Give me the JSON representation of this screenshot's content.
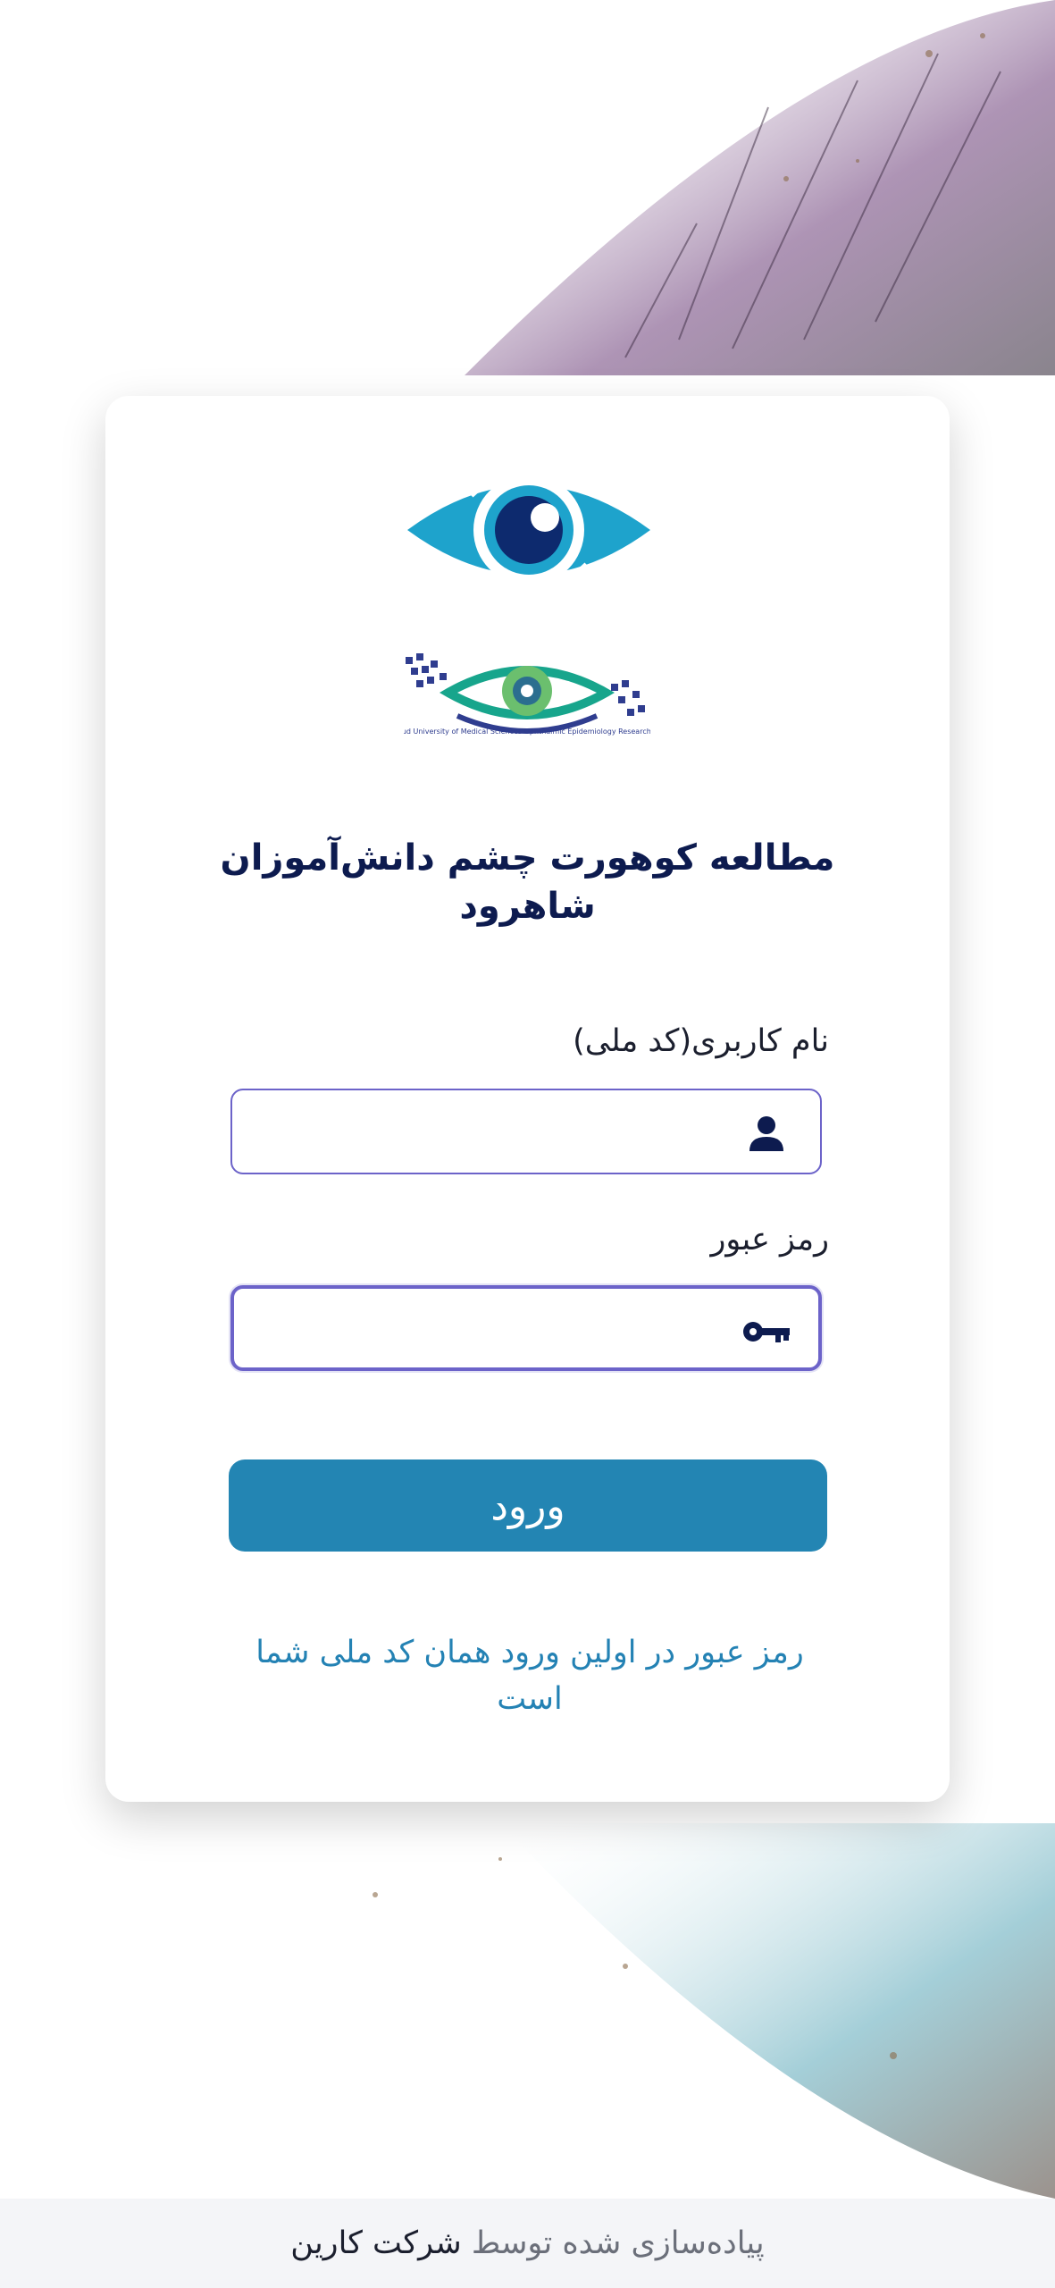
{
  "card": {
    "title": "مطالعه کوهورت چشم دانش‌آموزان شاهرود",
    "logo_research_text": "Shahroud University of Medical Sciences Ophthalmic Epidemiology Research Center"
  },
  "form": {
    "username_label": "نام کاربری(کد ملی)",
    "username_value": "",
    "username_icon": "user-icon",
    "password_label": "رمز عبور",
    "password_value": "",
    "password_icon": "key-icon",
    "submit_label": "ورود",
    "hint_text": "رمز عبور در اولین ورود همان کد ملی شما است"
  },
  "footer": {
    "prefix": "پیاده‌سازی شده توسط",
    "company": "شرکت کارین"
  },
  "colors": {
    "accent": "#2385b3",
    "title": "#0d1b4f",
    "input_border": "#6c63c9",
    "hint": "#2482b4"
  }
}
